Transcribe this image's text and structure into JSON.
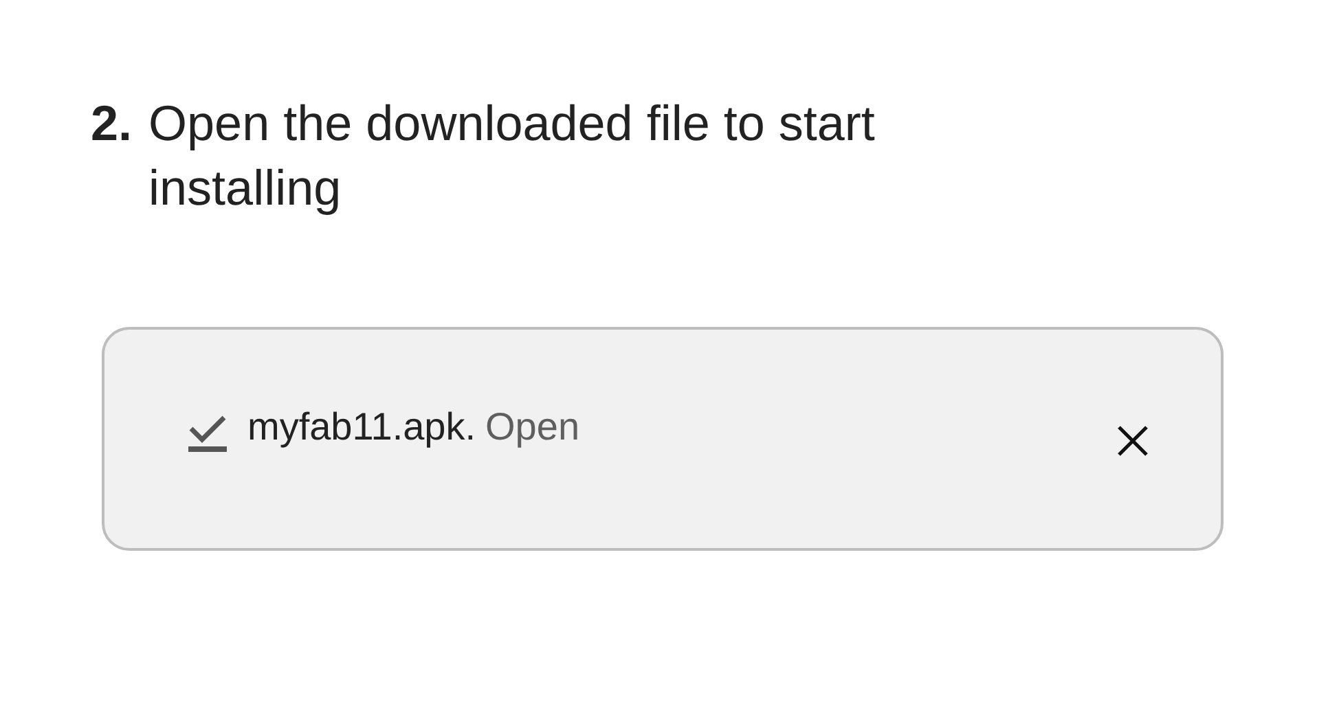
{
  "step": {
    "number": "2.",
    "text": "Open the downloaded file to start installing"
  },
  "download": {
    "filename": "myfab11.apk.",
    "action": "Open"
  }
}
